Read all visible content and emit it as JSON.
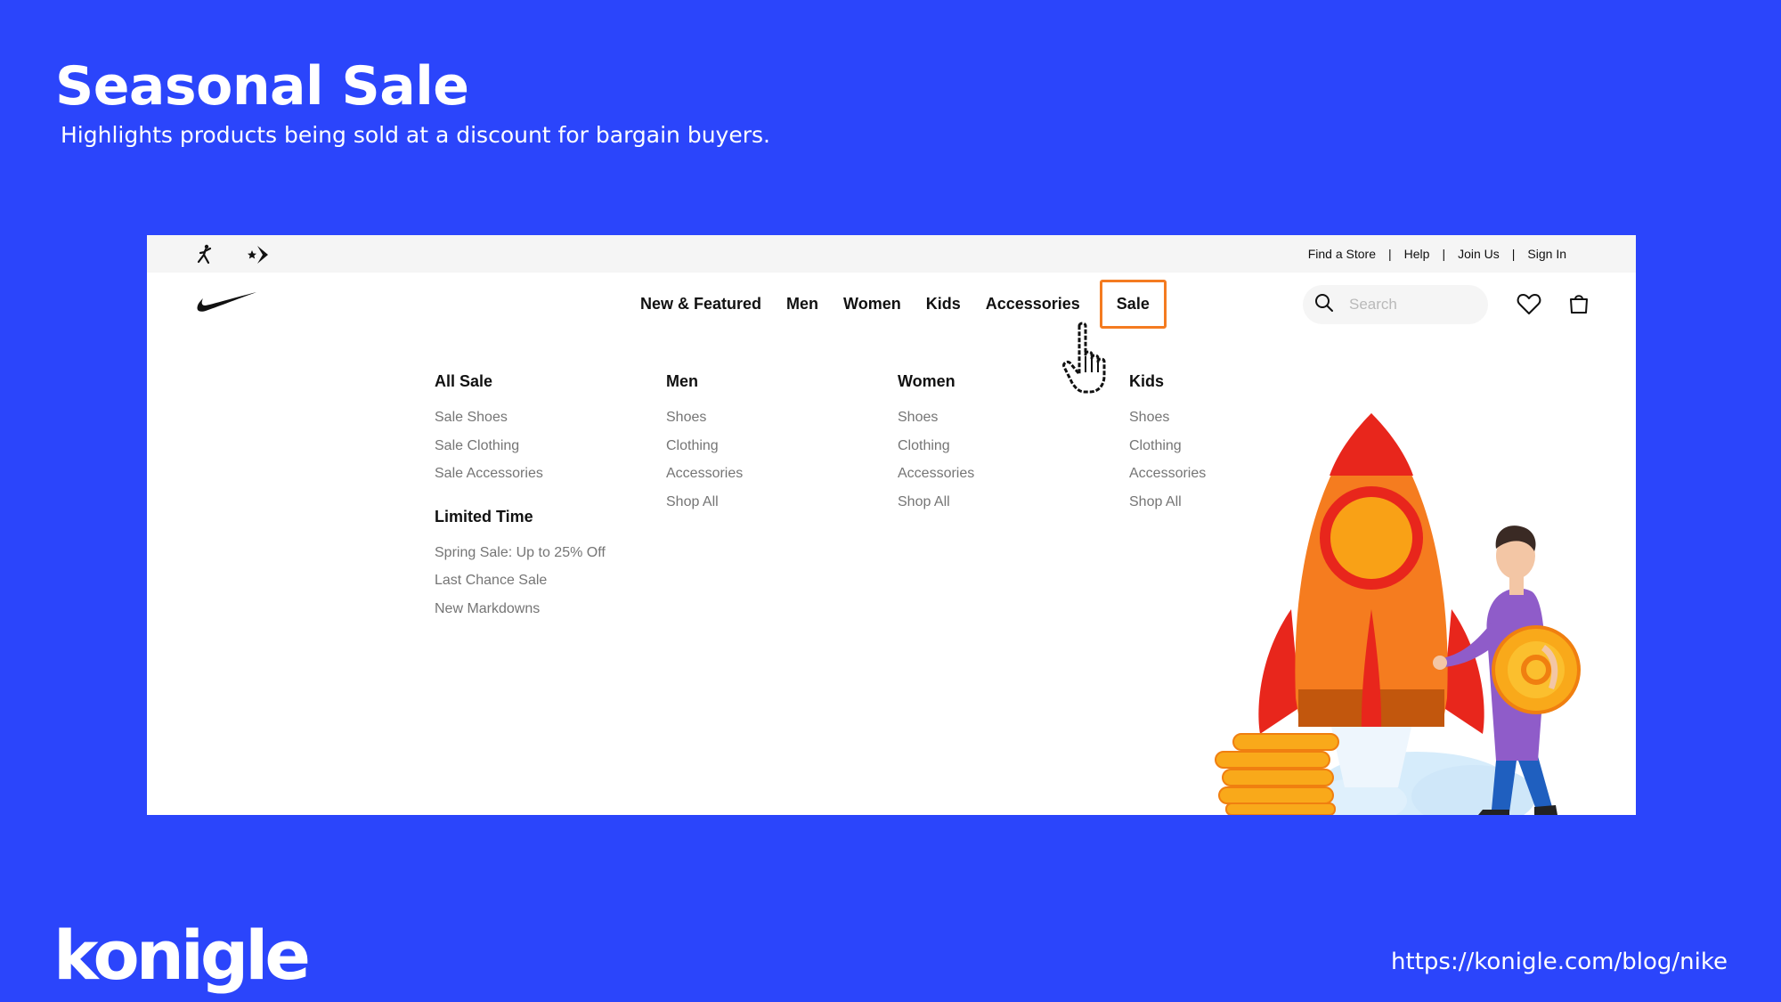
{
  "slide": {
    "title": "Seasonal Sale",
    "subtitle": "Highlights products being sold at a discount for bargain buyers.",
    "logo": "konigle",
    "url": "https://konigle.com/blog/nike"
  },
  "utility_bar": {
    "links": [
      "Find a Store",
      "Help",
      "Join Us",
      "Sign In"
    ],
    "separator": "|",
    "brand_icons": [
      "jordan-jumpman-icon",
      "converse-icon"
    ]
  },
  "nav": {
    "logo_icon": "nike-swoosh-icon",
    "items": [
      "New & Featured",
      "Men",
      "Women",
      "Kids",
      "Accessories"
    ],
    "sale": "Sale",
    "search_placeholder": "Search",
    "icons": [
      "search-icon",
      "heart-icon",
      "bag-icon"
    ]
  },
  "menu": {
    "all_sale": {
      "heading": "All Sale",
      "items": [
        "Sale Shoes",
        "Sale Clothing",
        "Sale Accessories"
      ]
    },
    "limited_time": {
      "heading": "Limited Time",
      "items": [
        "Spring Sale: Up to 25% Off",
        "Last Chance Sale",
        "New Markdowns"
      ]
    },
    "men": {
      "heading": "Men",
      "items": [
        "Shoes",
        "Clothing",
        "Accessories",
        "Shop All"
      ]
    },
    "women": {
      "heading": "Women",
      "items": [
        "Shoes",
        "Clothing",
        "Accessories",
        "Shop All"
      ]
    },
    "kids": {
      "heading": "Kids",
      "items": [
        "Shoes",
        "Clothing",
        "Accessories",
        "Shop All"
      ]
    }
  },
  "colors": {
    "background": "#2b45fb",
    "sale_highlight": "#f47b20",
    "menu_item": "#757575"
  }
}
